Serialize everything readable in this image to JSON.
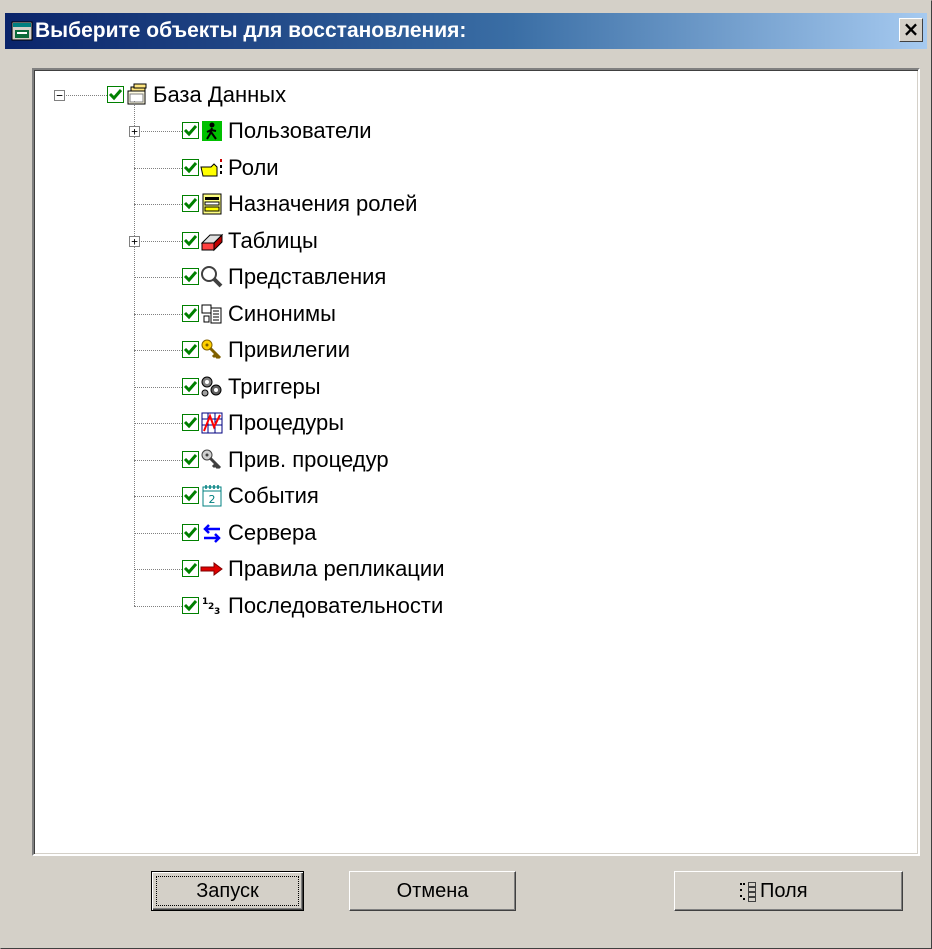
{
  "window": {
    "title": "Выберите объекты для восстановления:",
    "close_label": "×",
    "app_icon": "db-window-icon"
  },
  "tree": {
    "root": {
      "label": "База Данных",
      "icon": "database-folders-icon",
      "checked": true,
      "expanded": true,
      "expander": "−"
    },
    "children": [
      {
        "label": "Пользователи",
        "icon": "user-icon",
        "checked": true,
        "expander": "+"
      },
      {
        "label": "Роли",
        "icon": "role-hand-icon",
        "checked": true
      },
      {
        "label": "Назначения ролей",
        "icon": "role-grant-icon",
        "checked": true
      },
      {
        "label": "Таблицы",
        "icon": "table-icon",
        "checked": true,
        "expander": "+"
      },
      {
        "label": "Представления",
        "icon": "view-magnifier-icon",
        "checked": true
      },
      {
        "label": "Синонимы",
        "icon": "synonym-icon",
        "checked": true
      },
      {
        "label": "Привилегии",
        "icon": "key-icon",
        "checked": true
      },
      {
        "label": "Триггеры",
        "icon": "trigger-gears-icon",
        "checked": true
      },
      {
        "label": "Процедуры",
        "icon": "procedure-icon",
        "checked": true
      },
      {
        "label": "Прив. процедур",
        "icon": "procedure-key-icon",
        "checked": true
      },
      {
        "label": "События",
        "icon": "calendar-icon",
        "checked": true
      },
      {
        "label": "Сервера",
        "icon": "server-arrows-icon",
        "checked": true
      },
      {
        "label": "Правила репликации",
        "icon": "replication-arrow-icon",
        "checked": true
      },
      {
        "label": "Последовательности",
        "icon": "sequence-icon",
        "checked": true
      }
    ]
  },
  "buttons": {
    "run": "Запуск",
    "cancel": "Отмена",
    "fields": "Поля"
  },
  "colors": {
    "title_start": "#0a246a",
    "title_end": "#a6caf0",
    "check": "#008000",
    "face": "#d4d0c8"
  }
}
